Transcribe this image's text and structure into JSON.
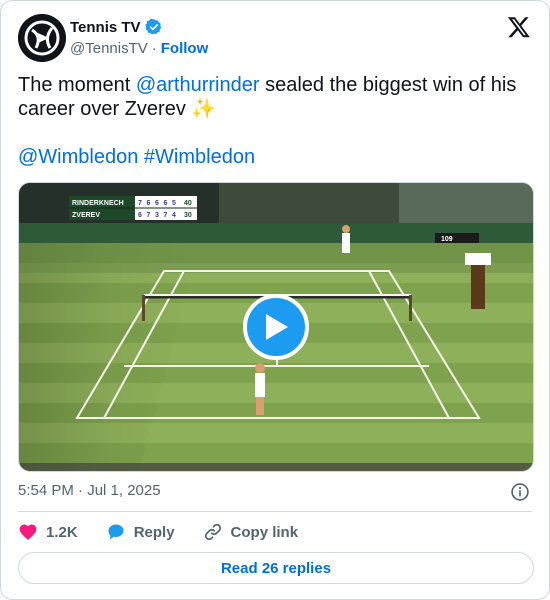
{
  "author": {
    "display_name": "Tennis TV",
    "handle": "@TennisTV",
    "separator": "·",
    "follow_label": "Follow",
    "verified": true,
    "avatar_icon": "tennis-tv-logo-icon"
  },
  "tweet": {
    "text_part1": "The moment ",
    "mention": "@arthurrinder",
    "text_part2": " sealed the biggest win of his career over Zverev ✨",
    "hashtag1": "@Wimbledon",
    "hashtag2": "#Wimbledon"
  },
  "media": {
    "type": "video",
    "scoreboard": {
      "player1": "RINDERKNECH",
      "player1_sets": [
        "7",
        "6",
        "6",
        "6",
        "5"
      ],
      "player1_points": "40",
      "player2": "ZVEREV",
      "player2_sets": [
        "6",
        "7",
        "3",
        "7",
        "4"
      ],
      "player2_points": "30",
      "speed": "109"
    },
    "play_icon": "play-icon"
  },
  "meta": {
    "timestamp": "5:54 PM · Jul 1, 2025"
  },
  "actions": {
    "likes_count": "1.2K",
    "reply_label": "Reply",
    "copy_link_label": "Copy link"
  },
  "read_replies_label": "Read 26 replies",
  "colors": {
    "link": "#006fd6",
    "verified": "#1d9bf0",
    "like": "#f91880",
    "reply": "#1d9bf0",
    "grass_light": "#8fb05a",
    "grass_dark": "#6c9344"
  }
}
